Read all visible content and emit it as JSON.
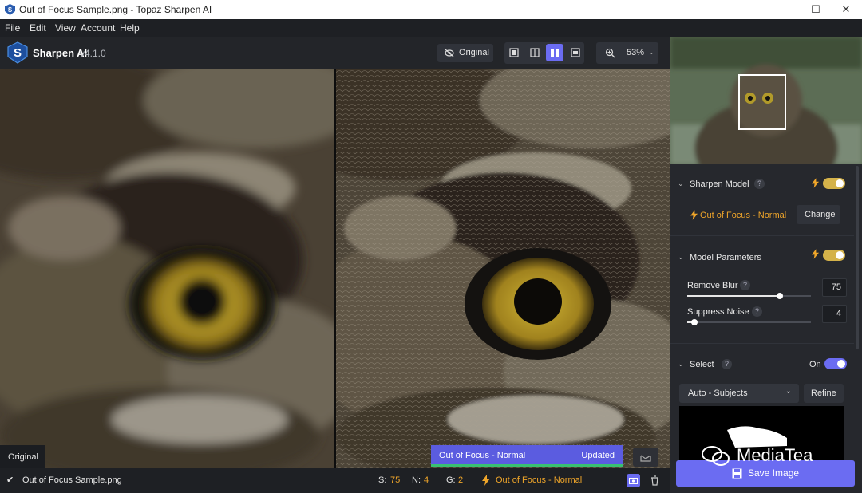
{
  "window": {
    "title": "Out of Focus Sample.png - Topaz Sharpen AI",
    "controls": {
      "minimize": "—",
      "maximize": "☐",
      "close": "✕"
    }
  },
  "menu": [
    "File",
    "Edit",
    "View",
    "Account",
    "Help"
  ],
  "toolbar": {
    "app_name": "Sharpen AI",
    "version": "v4.1.0",
    "original_button": "Original",
    "zoom": "53%"
  },
  "canvas": {
    "left_label": "Original",
    "model_tag": "Out of Focus - Normal",
    "model_status": "Updated"
  },
  "status": {
    "filename": "Out of Focus Sample.png",
    "s_label": "S:",
    "s_value": "75",
    "n_label": "N:",
    "n_value": "4",
    "g_label": "G:",
    "g_value": "2",
    "model": "Out of Focus - Normal"
  },
  "panel": {
    "sharpen_model": {
      "title": "Sharpen Model",
      "help": "?",
      "enabled": true,
      "model_name": "Out of Focus - Normal",
      "change_button": "Change"
    },
    "model_parameters": {
      "title": "Model Parameters",
      "help": "?",
      "enabled": true,
      "remove_blur": {
        "label": "Remove Blur",
        "help": "?",
        "value": "75",
        "level": 0.75
      },
      "suppress_noise": {
        "label": "Suppress Noise",
        "help": "?",
        "value": "4",
        "level": 0.04
      }
    },
    "select": {
      "title": "Select",
      "help": "?",
      "state": "On",
      "dropdown": "Auto - Subjects",
      "refine_button": "Refine"
    },
    "save_button": "Save Image"
  },
  "watermark": "MediaTea",
  "colors": {
    "accent": "#6b6cf2",
    "toggle": "#d4b24a",
    "lightning": "#f0a62a"
  }
}
